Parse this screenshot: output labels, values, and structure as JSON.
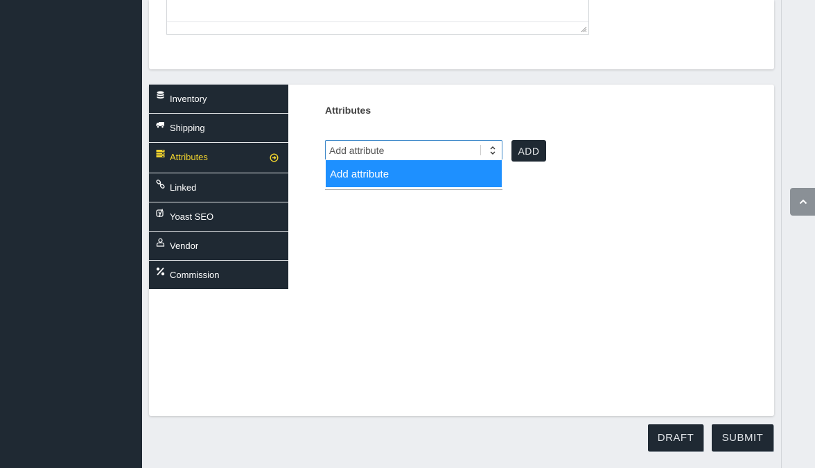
{
  "tabs": [
    {
      "label": "Inventory",
      "icon": "database-icon",
      "active": false
    },
    {
      "label": "Shipping",
      "icon": "truck-icon",
      "active": false
    },
    {
      "label": "Attributes",
      "icon": "server-icon",
      "active": true
    },
    {
      "label": "Linked",
      "icon": "link-icon",
      "active": false
    },
    {
      "label": "Yoast SEO",
      "icon": "yoast-icon",
      "active": false
    },
    {
      "label": "Vendor",
      "icon": "user-icon",
      "active": false
    },
    {
      "label": "Commission",
      "icon": "percent-icon",
      "active": false
    }
  ],
  "attributes": {
    "title": "Attributes",
    "select_value": "Add attribute",
    "options": [
      "Add attribute"
    ],
    "add_label": "ADD"
  },
  "footer": {
    "draft_label": "DRAFT",
    "submit_label": "SUBMIT"
  },
  "colors": {
    "sidebar": "#1f2933",
    "active_tab_text": "#f2d42e",
    "option_highlight": "#1e90ff",
    "page_bg": "#eceef1"
  }
}
